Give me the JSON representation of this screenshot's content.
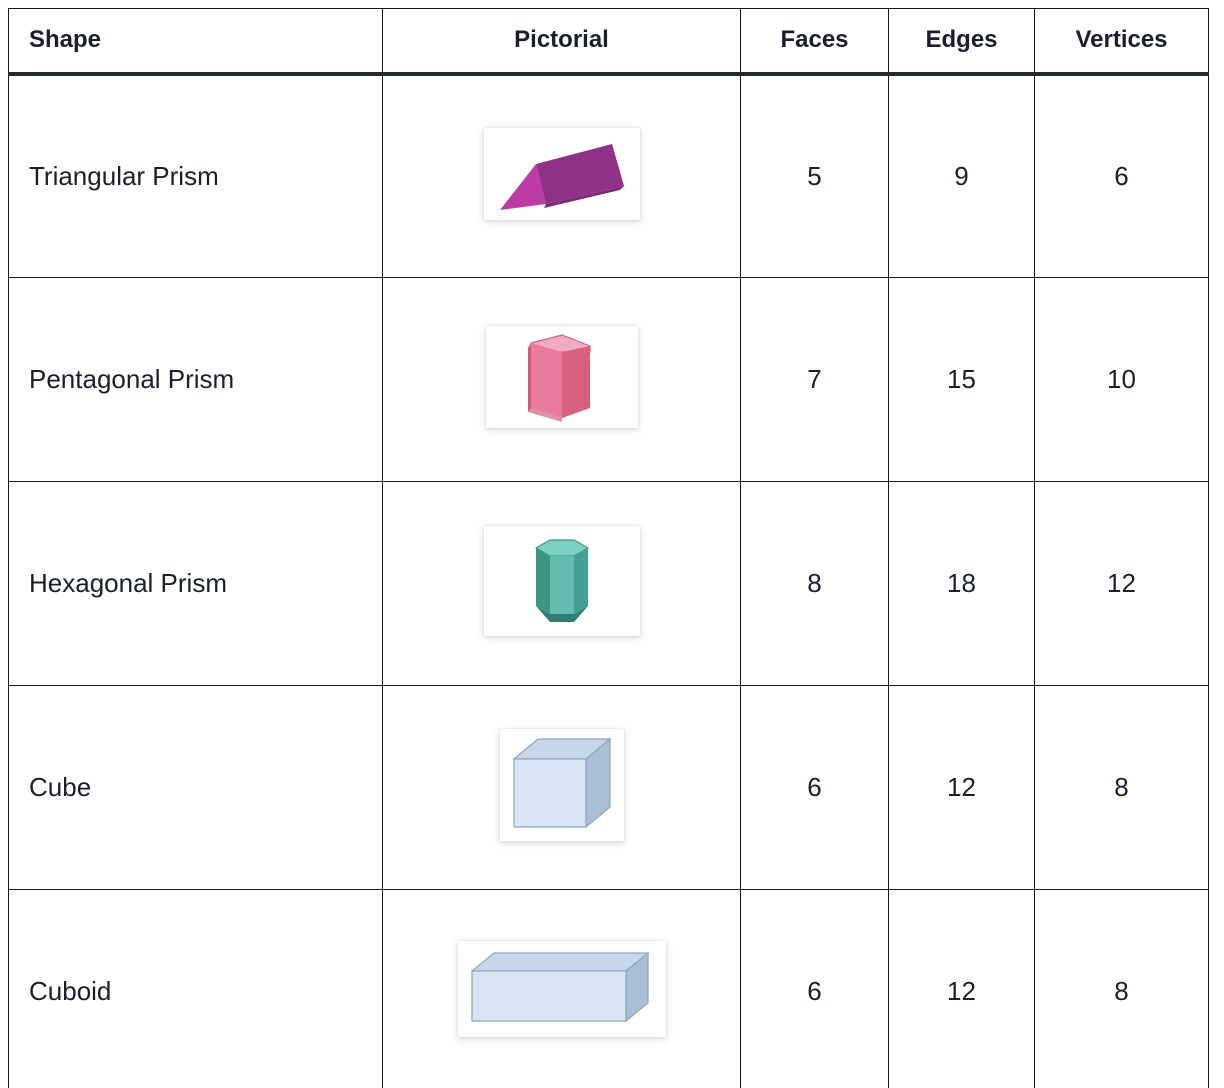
{
  "table": {
    "headers": [
      {
        "label": "Shape",
        "align": "left"
      },
      {
        "label": "Pictorial",
        "align": "center"
      },
      {
        "label": "Faces",
        "align": "center"
      },
      {
        "label": "Edges",
        "align": "center"
      },
      {
        "label": "Vertices",
        "align": "center"
      }
    ],
    "rows": [
      {
        "shape": "Triangular Prism",
        "pictorial": "triangular-prism-image",
        "faces": "5",
        "edges": "9",
        "vertices": "6"
      },
      {
        "shape": "Pentagonal Prism",
        "pictorial": "pentagonal-prism-image",
        "faces": "7",
        "edges": "15",
        "vertices": "10"
      },
      {
        "shape": "Hexagonal Prism",
        "pictorial": "hexagonal-prism-image",
        "faces": "8",
        "edges": "18",
        "vertices": "12"
      },
      {
        "shape": "Cube",
        "pictorial": "cube-image",
        "faces": "6",
        "edges": "12",
        "vertices": "8"
      },
      {
        "shape": "Cuboid",
        "pictorial": "cuboid-image",
        "faces": "6",
        "edges": "12",
        "vertices": "8"
      }
    ]
  },
  "colors": {
    "text": "#18202f",
    "border": "#14181f",
    "header_rule": "#242a34",
    "triangular_prism_front": "#8e3187",
    "triangular_prism_end": "#bc3ba6",
    "triangular_prism_top": "#92318a",
    "pentagonal_prism_front": "#e87a9e",
    "pentagonal_prism_side": "#d8607f",
    "pentagonal_prism_top": "#f0acc2",
    "hexagonal_prism_front": "#63bcaf",
    "hexagonal_prism_side": "#3e9485",
    "hexagonal_prism_top": "#7fd0c4",
    "cube_front": "#d7e5f3",
    "cube_top": "#c6d7e9",
    "cube_side": "#aabfd5",
    "cube_outline": "#8fa6bd"
  }
}
